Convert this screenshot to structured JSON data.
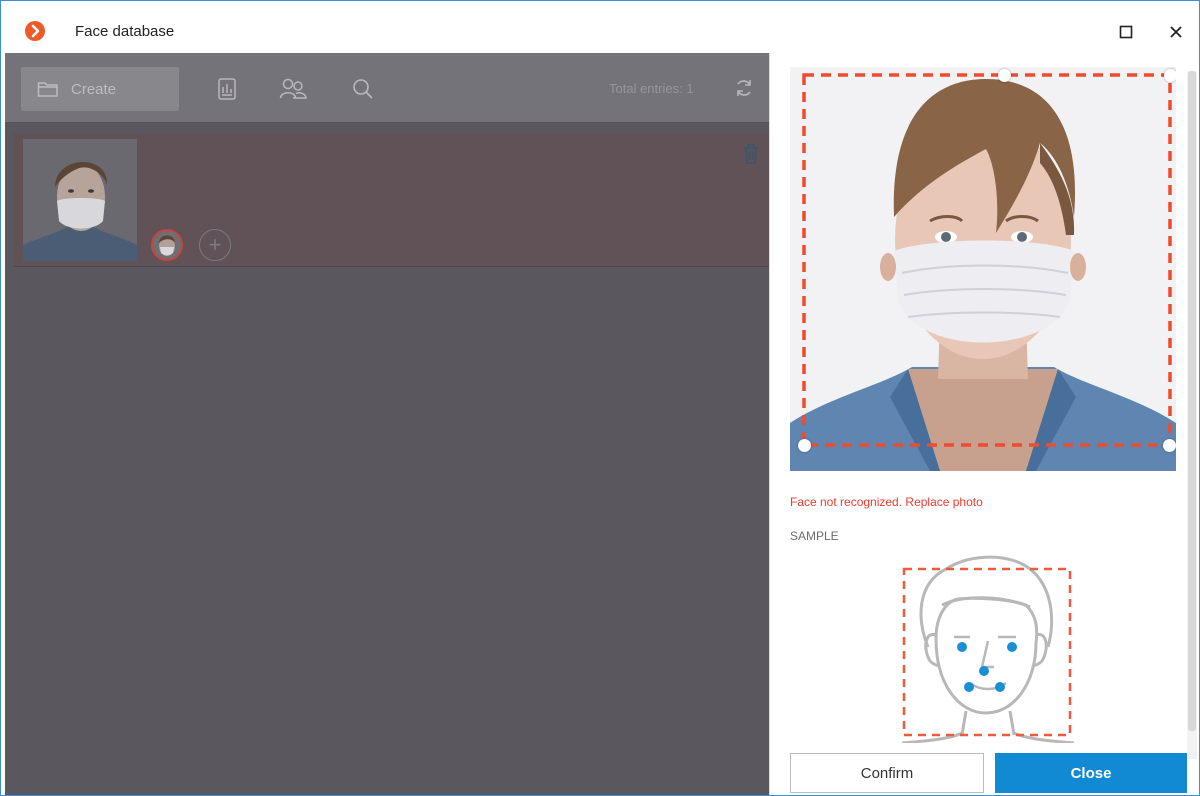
{
  "window": {
    "title": "Face database",
    "accent": "#1289d3",
    "logo_color": "#ef5a29"
  },
  "toolbar": {
    "create_label": "Create",
    "icons": [
      "folder-icon",
      "report-icon",
      "people-icon",
      "search-icon",
      "refresh-icon"
    ],
    "total_entries_label": "Total entries: 1"
  },
  "entries": [
    {
      "row_icon": "trash-icon",
      "add_icon": "add-face-icon"
    }
  ],
  "panel": {
    "error_message": "Face not recognized. Replace photo",
    "error_color": "#ef3b2d",
    "sample_label": "SAMPLE",
    "confirm_label": "Confirm",
    "close_label": "Close"
  }
}
